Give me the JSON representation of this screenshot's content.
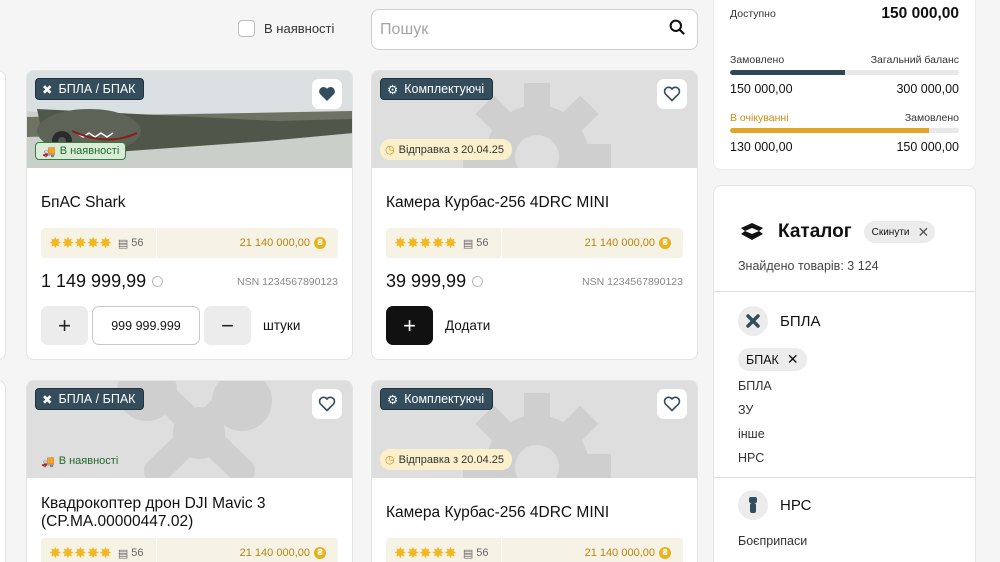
{
  "filters": {
    "in_stock_label": "В наявності",
    "search_placeholder": "Пошук"
  },
  "products": [
    {
      "category": "БПЛА / БПАК",
      "badge": "В наявності",
      "title": "БпАС Shark",
      "reviews": "56",
      "bonus": "21 140 000,00",
      "price": "1 149 999,99",
      "nsn": "NSN 1234567890123",
      "qty": "999 999.999",
      "unit": "штуки",
      "favorite": true
    },
    {
      "category": "Комплектуючі",
      "badge": "Відправка з 20.04.25",
      "title": "Камера Курбас-256 4DRC MINI",
      "reviews": "56",
      "bonus": "21 140 000,00",
      "price": "39 999,99",
      "nsn": "NSN 1234567890123",
      "add_label": "Додати",
      "favorite": false
    },
    {
      "category": "БПЛА / БПАК",
      "badge": "В наявності",
      "title": "Квадрокоптер дрон DJI Mavic 3 (CP.MA.00000447.02)",
      "reviews": "56",
      "bonus": "21 140 000,00",
      "favorite": false
    },
    {
      "category": "Комплектуючі",
      "badge": "Відправка з 20.04.25",
      "title": "Камера Курбас-256 4DRC MINI",
      "reviews": "56",
      "bonus": "21 140 000,00",
      "favorite": false
    }
  ],
  "balance": {
    "available_label": "Доступно",
    "available_value": "150 000,00",
    "ordered_label": "Замовлено",
    "total_label": "Загальний баланс",
    "ordered_value": "150 000,00",
    "total_value": "300 000,00",
    "ordered_fraction": 0.5,
    "pending_label": "В очікуванні",
    "pending_ordered_label": "Замовлено",
    "pending_value": "130 000,00",
    "pending_ordered_value": "150 000,00",
    "pending_fraction": 0.87,
    "colors": {
      "ordered": "#2f4858",
      "pending": "#e0a526"
    }
  },
  "catalog": {
    "title": "Каталог",
    "reset_label": "Скинути",
    "found": "Знайдено товарів: 3 124",
    "sections": [
      {
        "title": "БПЛА",
        "chip": "БПАК",
        "options": [
          "БПЛА",
          "ЗУ",
          "інше",
          "НРС"
        ]
      },
      {
        "title": "НРС",
        "options": [
          "Боєприпаси"
        ]
      }
    ]
  },
  "colors": {
    "category_chip": "#344d5c",
    "star": "#f2b821",
    "in_stock": "#1f6b2a",
    "ship_badge": "#fbf0cc"
  }
}
